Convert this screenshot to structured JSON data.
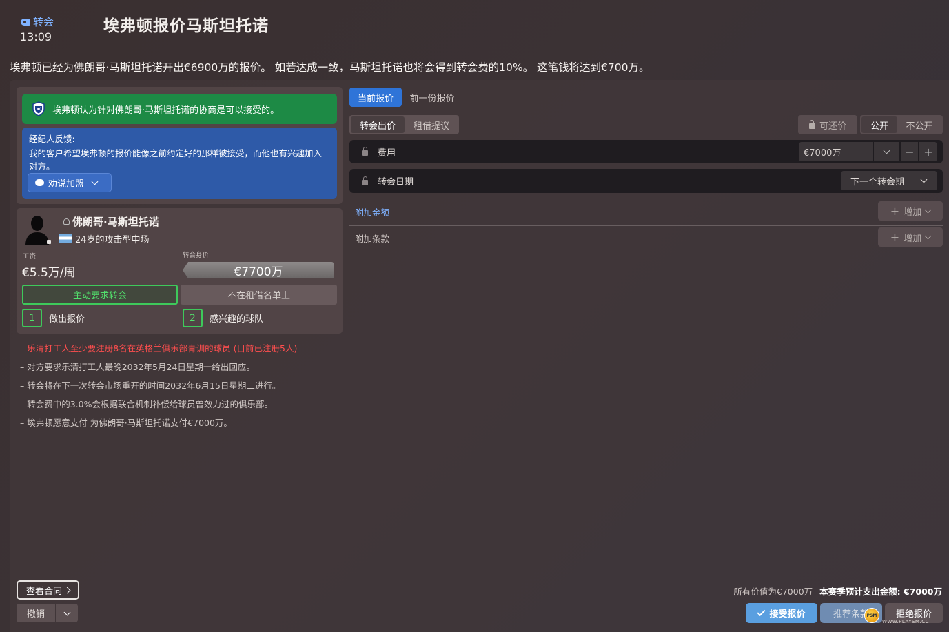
{
  "header": {
    "back_label": "转会",
    "time": "13:09",
    "title": "埃弗顿报价马斯坦托诺",
    "headline": "埃弗顿已经为佛朗哥·马斯坦托诺开出€6900万的报价。 如若达成一致，马斯坦托诺也将会得到转会费的10%。 这笔钱将达到€700万。"
  },
  "left": {
    "banner_text": "埃弗顿认为针对佛朗哥·马斯坦托诺的协商是可以接受的。",
    "agent_title": "经纪人反馈:",
    "agent_text": "我的客户希望埃弗顿的报价能像之前约定好的那样被接受，而他也有兴趣加入对方。",
    "persuade_label": "劝说加盟",
    "player": {
      "name": "佛朗哥·马斯坦托诺",
      "description": "24岁的攻击型中场",
      "wage_label": "工资",
      "wage": "€5.5万/周",
      "value_label": "转会身价",
      "value": "€7700万",
      "transfer_status": "主动要求转会",
      "loan_status": "不在租借名单上",
      "offers_count": "1",
      "offers_label": "做出报价",
      "interested_count": "2",
      "interested_label": "感兴趣的球队"
    },
    "notes": [
      "– 乐清打工人至少要注册8名在英格兰俱乐部青训的球员 (目前已注册5人)",
      "– 对方要求乐清打工人最晚2032年5月24日星期一给出回应。",
      "– 转会将在下一次转会市场重开的时间2032年6月15日星期二进行。",
      "– 转会费中的3.0%会根据联合机制补偿给球员曾效力过的俱乐部。",
      "– 埃弗顿愿意支付 为佛朗哥·马斯坦托诺支付€7000万。"
    ]
  },
  "right": {
    "tab_current": "当前报价",
    "tab_previous": "前一份报价",
    "seg_transfer": "转会出价",
    "seg_loan": "租借提议",
    "negotiable_label": "可还价",
    "public_label": "公开",
    "private_label": "不公开",
    "fee_label": "费用",
    "fee_value": "€7000万",
    "date_label": "转会日期",
    "date_value": "下一个转会期",
    "addons_label": "附加金额",
    "add_label": "增加",
    "clauses_label": "附加条款"
  },
  "footer": {
    "view_contract": "查看合同",
    "undo": "撤销",
    "total_value": "所有价值为€7000万",
    "season_spend": "本赛季预计支出金额: €7000万",
    "accept": "接受报价",
    "suggest": "推荐条款",
    "reject": "拒绝报价",
    "watermark": "WWW.PLAYSM.CC",
    "watermark_badge": "PSM"
  },
  "colors": {
    "accent_blue": "#2f74d8",
    "success_green": "#1d8a45",
    "agent_blue": "#2e5aa8",
    "warning_red": "#ff4e4e"
  }
}
